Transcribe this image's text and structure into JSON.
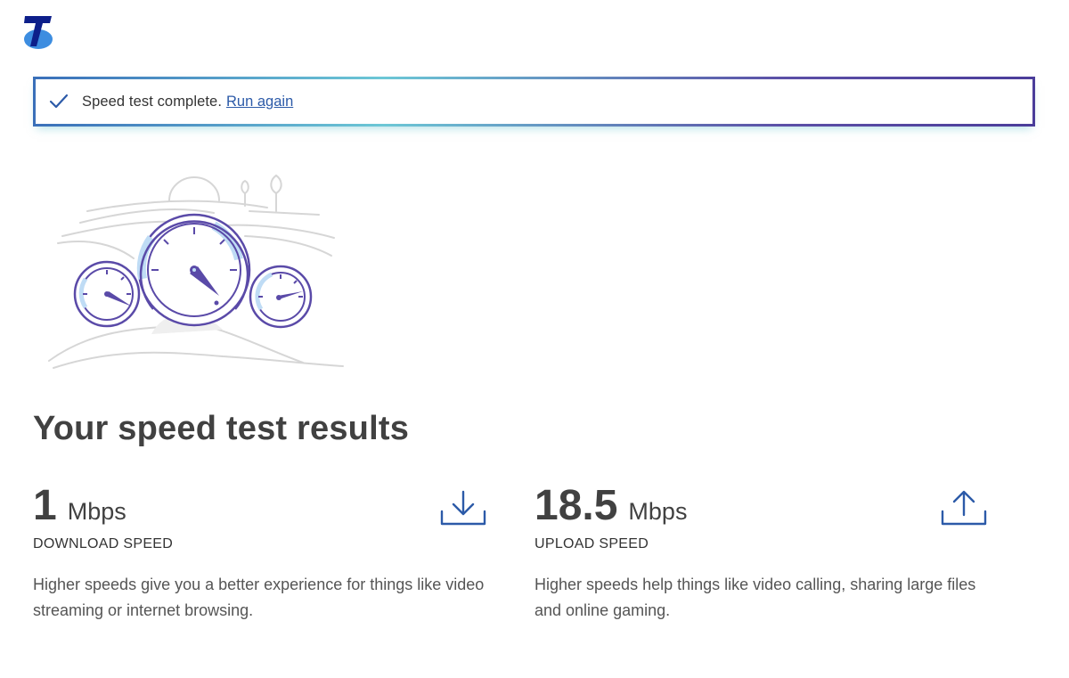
{
  "banner": {
    "message": "Speed test complete.",
    "link_label": "Run again"
  },
  "heading": "Your speed test results",
  "download": {
    "value": "1",
    "unit": "Mbps",
    "label": "DOWNLOAD SPEED",
    "description": "Higher speeds give you a better experience for things like video streaming or internet browsing.",
    "icon": "download-icon"
  },
  "upload": {
    "value": "18.5",
    "unit": "Mbps",
    "label": "UPLOAD SPEED",
    "description": "Higher speeds help things like video calling, sharing large files and online gaming.",
    "icon": "upload-icon"
  },
  "colors": {
    "accent_blue": "#2c5aa8",
    "gauge_purple": "#5a4aa8",
    "gauge_fill": "#bfdcf5",
    "text_dark": "#414141"
  }
}
